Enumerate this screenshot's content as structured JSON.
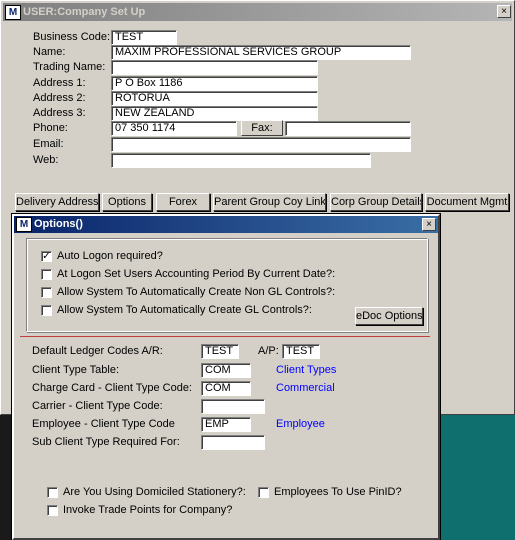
{
  "window": {
    "title": "USER:Company Set Up",
    "icon_label": "M",
    "close_glyph": "×"
  },
  "company": {
    "business_code_label": "Business Code:",
    "business_code_value": "TEST",
    "name_label": "Name:",
    "name_value": "MAXIM PROFESSIONAL SERVICES GROUP",
    "trading_name_label": "Trading Name:",
    "trading_name_value": "",
    "address1_label": "Address 1:",
    "address1_value": "P O Box 1186",
    "address2_label": "Address 2:",
    "address2_value": "ROTORUA",
    "address3_label": "Address 3:",
    "address3_value": "NEW ZEALAND",
    "phone_label": "Phone:",
    "phone_value": "07 350 1174",
    "fax_label": "Fax:",
    "fax_value": "",
    "email_label": "Email:",
    "email_value": "",
    "web_label": "Web:",
    "web_value": ""
  },
  "tabs": {
    "delivery_address": "Delivery Address",
    "options": "Options",
    "forex": "Forex",
    "parent_group": "Parent Group Coy Links",
    "corp_group": "Corp Group Details",
    "document_mgmt": "Document Mgmt"
  },
  "dialog": {
    "title": "Options()",
    "icon_label": "M",
    "close_glyph": "×",
    "auto_logon": {
      "label": "Auto Logon required?",
      "checked": true,
      "mark": "✓"
    },
    "logon_period": {
      "label": "At Logon Set Users Accounting Period By Current Date?:",
      "checked": false
    },
    "non_gl": {
      "label": "Allow System To Automatically Create Non GL Controls?:",
      "checked": false
    },
    "gl": {
      "label": "Allow System To Automatically Create GL Controls?:",
      "checked": false
    },
    "edoc_button": "eDoc Options",
    "ledger_ar_label": "Default Ledger Codes A/R:",
    "ledger_ar_value": "TEST",
    "ledger_ap_label": "A/P:",
    "ledger_ap_value": "TEST",
    "client_type_label": "Client Type Table:",
    "client_type_value": "COM",
    "client_type_link": "Client Types",
    "charge_card_label": "Charge Card - Client Type Code:",
    "charge_card_value": "COM",
    "charge_card_link": "Commercial",
    "carrier_label": "Carrier - Client Type Code:",
    "carrier_value": "",
    "employee_label": "Employee - Client Type Code",
    "employee_value": "EMP",
    "employee_link": "Employee",
    "sub_client_label": "Sub Client Type Required For:",
    "sub_client_value": "",
    "domiciled": {
      "label": "Are You  Using Domiciled Stationery?:",
      "checked": false
    },
    "pin_id": {
      "label": "Employees To Use PinID?",
      "checked": false
    },
    "trade_points": {
      "label": "Invoke Trade Points for Company?",
      "checked": false
    }
  },
  "colors": {
    "dialog_title": "#0a246a",
    "link": "#0000ff",
    "divider": "#c04040",
    "desktop": "#0f6e6e"
  }
}
